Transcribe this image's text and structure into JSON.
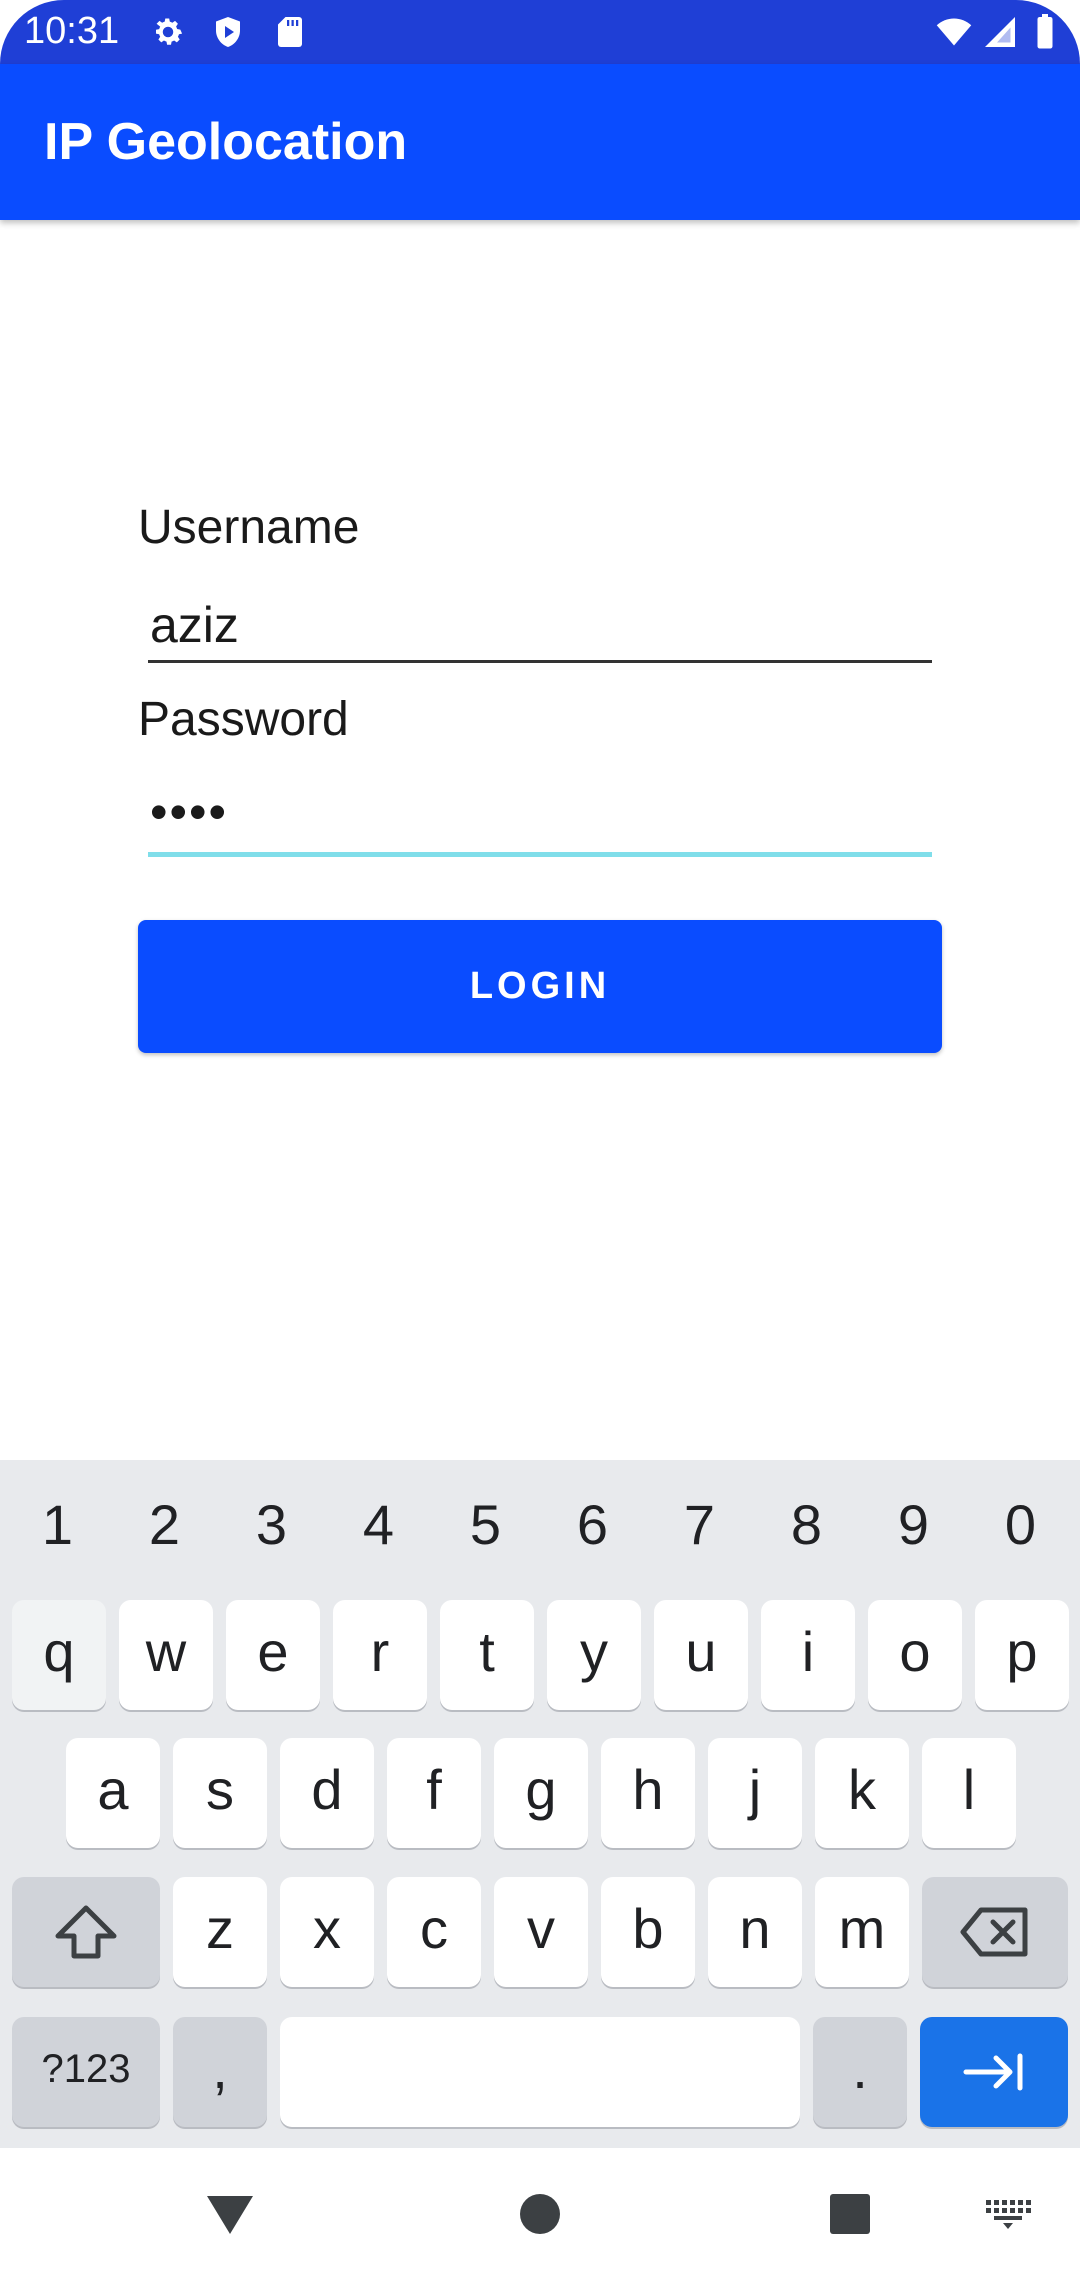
{
  "status_bar": {
    "time": "10:31"
  },
  "app_bar": {
    "title": "IP Geolocation"
  },
  "form": {
    "username_label": "Username",
    "username_value": "aziz",
    "password_label": "Password",
    "password_value": "••••",
    "login_label": "LOGIN"
  },
  "keyboard": {
    "number_row": [
      "1",
      "2",
      "3",
      "4",
      "5",
      "6",
      "7",
      "8",
      "9",
      "0"
    ],
    "row1": [
      "q",
      "w",
      "e",
      "r",
      "t",
      "y",
      "u",
      "i",
      "o",
      "p"
    ],
    "row2": [
      "a",
      "s",
      "d",
      "f",
      "g",
      "h",
      "j",
      "k",
      "l"
    ],
    "row3": [
      "z",
      "x",
      "c",
      "v",
      "b",
      "n",
      "m"
    ],
    "symbols_key": "?123",
    "comma_key": ",",
    "period_key": "."
  },
  "colors": {
    "status_bar": "#1f3fd6",
    "app_bar": "#0a4cff",
    "button": "#0a4cff",
    "focused_underline": "#80deea",
    "enter_key": "#1a73e8"
  },
  "icons": {
    "status": [
      "gear-icon",
      "shield-play-icon",
      "sd-card-icon",
      "wifi-icon",
      "cellular-signal-icon",
      "battery-icon"
    ],
    "keyboard": [
      "shift-icon",
      "backspace-icon",
      "enter-tab-icon"
    ],
    "nav": [
      "back-icon",
      "home-icon",
      "recents-icon",
      "keyboard-switch-icon"
    ]
  }
}
